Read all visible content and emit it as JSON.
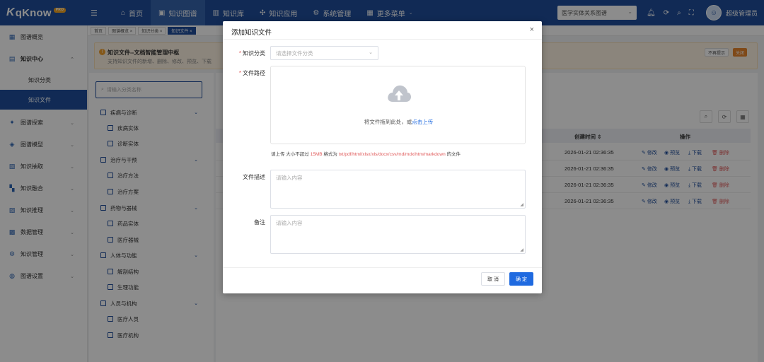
{
  "app": {
    "logo_text": "qKnow",
    "logo_badge": "PRO"
  },
  "topnav": [
    {
      "label": "首页",
      "icon": "home-icon"
    },
    {
      "label": "知识图谱",
      "icon": "graph-icon",
      "active": true
    },
    {
      "label": "知识库",
      "icon": "library-icon"
    },
    {
      "label": "知识应用",
      "icon": "app-icon"
    },
    {
      "label": "系统管理",
      "icon": "settings-icon"
    },
    {
      "label": "更多菜单",
      "icon": "grid-icon"
    }
  ],
  "graph_select": "医学实体关系图谱",
  "user": {
    "name": "超级管理员"
  },
  "sidebar": {
    "items": [
      {
        "label": "图谱概览"
      },
      {
        "label": "知识中心"
      },
      {
        "label": "知识分类"
      },
      {
        "label": "知识文件"
      },
      {
        "label": "图谱探索"
      },
      {
        "label": "图谱模型"
      },
      {
        "label": "知识抽取"
      },
      {
        "label": "知识融合"
      },
      {
        "label": "知识推理"
      },
      {
        "label": "数据管理"
      },
      {
        "label": "知识管理"
      },
      {
        "label": "图谱设置"
      }
    ]
  },
  "tags": [
    "首页",
    "图谱概览 ×",
    "知识分类 ×",
    "知识文件 ×"
  ],
  "notice": {
    "title": "知识文件--文档智能管理中枢",
    "desc": "支持知识文件的新增、删除、修改、预览、下载",
    "dismiss": "不再提示",
    "close": "关闭"
  },
  "tree": {
    "search_placeholder": "请输入分类名称",
    "nodes": [
      "疾病与诊断",
      "疾病实体",
      "诊断实体",
      "治疗与干预",
      "治疗方法",
      "治疗方案",
      "药物与器械",
      "药品实体",
      "医疗器械",
      "人体与功能",
      "解剖结构",
      "生理功能",
      "人员与机构",
      "医疗人员",
      "医疗机构"
    ]
  },
  "table": {
    "headers": {
      "created": "创建时间 ⇕",
      "ops": "操作"
    },
    "rows": [
      {
        "created": "2026-01-21 02:36:35"
      },
      {
        "created": "2026-01-21 02:36:35"
      },
      {
        "created": "2026-01-21 02:36:35"
      },
      {
        "created": "2026-01-21 02:36:35"
      }
    ],
    "actions": {
      "edit": "修改",
      "preview": "预览",
      "download": "下载",
      "delete": "删除"
    }
  },
  "modal": {
    "title": "添加知识文件",
    "category_label": "知识分类",
    "category_placeholder": "请选择文件分类",
    "path_label": "文件路径",
    "upload_text": "将文件拖到此处，或",
    "upload_link": "点击上传",
    "hint_prefix": "请上传 大小不超过 ",
    "hint_size": "15MB",
    "hint_mid": " 格式为 ",
    "hint_formats": "txt/pdf/html/xlsx/xls/docx/csv/md/mdx/htm/markdown",
    "hint_suffix": " 的文件",
    "desc_label": "文件描述",
    "desc_placeholder": "请输入内容",
    "remark_label": "备注",
    "remark_placeholder": "请输入内容",
    "cancel": "取 消",
    "ok": "确 定"
  }
}
